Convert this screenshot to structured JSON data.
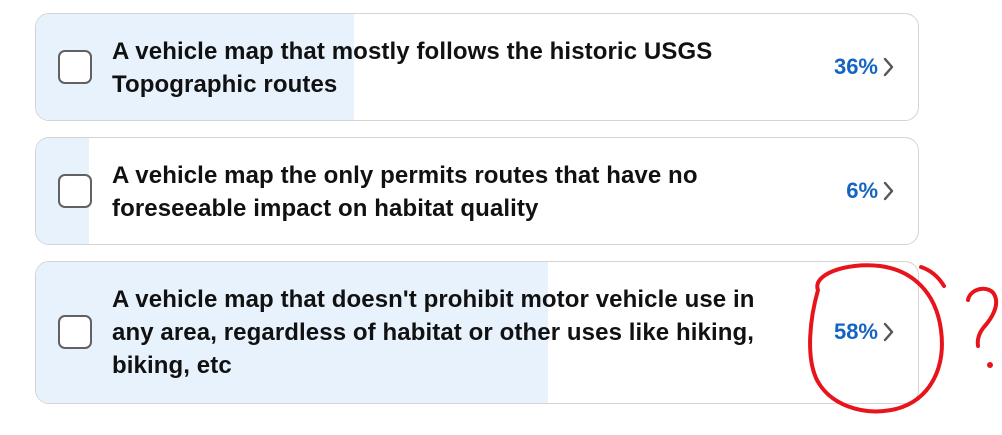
{
  "poll": {
    "options": [
      {
        "line1": "A vehicle map that mostly follows the historic USGS",
        "line2": "Topographic routes",
        "line3": "",
        "percent_label": "36%",
        "percent": 36,
        "checked": false
      },
      {
        "line1": "A vehicle map the only permits routes that have no",
        "line2": "foreseeable impact on habitat quality",
        "line3": "",
        "percent_label": "6%",
        "percent": 6,
        "checked": false
      },
      {
        "line1": "A vehicle map that doesn't prohibit motor vehicle use in",
        "line2": "any area, regardless of habitat or other uses like hiking,",
        "line3": "biking, etc",
        "percent_label": "58%",
        "percent": 58,
        "checked": false
      }
    ]
  },
  "annotation": {
    "mark": "?",
    "color": "#e8141c"
  },
  "colors": {
    "bar_fill": "#e7f2fd",
    "percent_text": "#1565c0",
    "border": "#d4d4d4"
  },
  "icons": {
    "checkbox": "checkbox-icon",
    "chevron": "chevron-right-icon"
  }
}
